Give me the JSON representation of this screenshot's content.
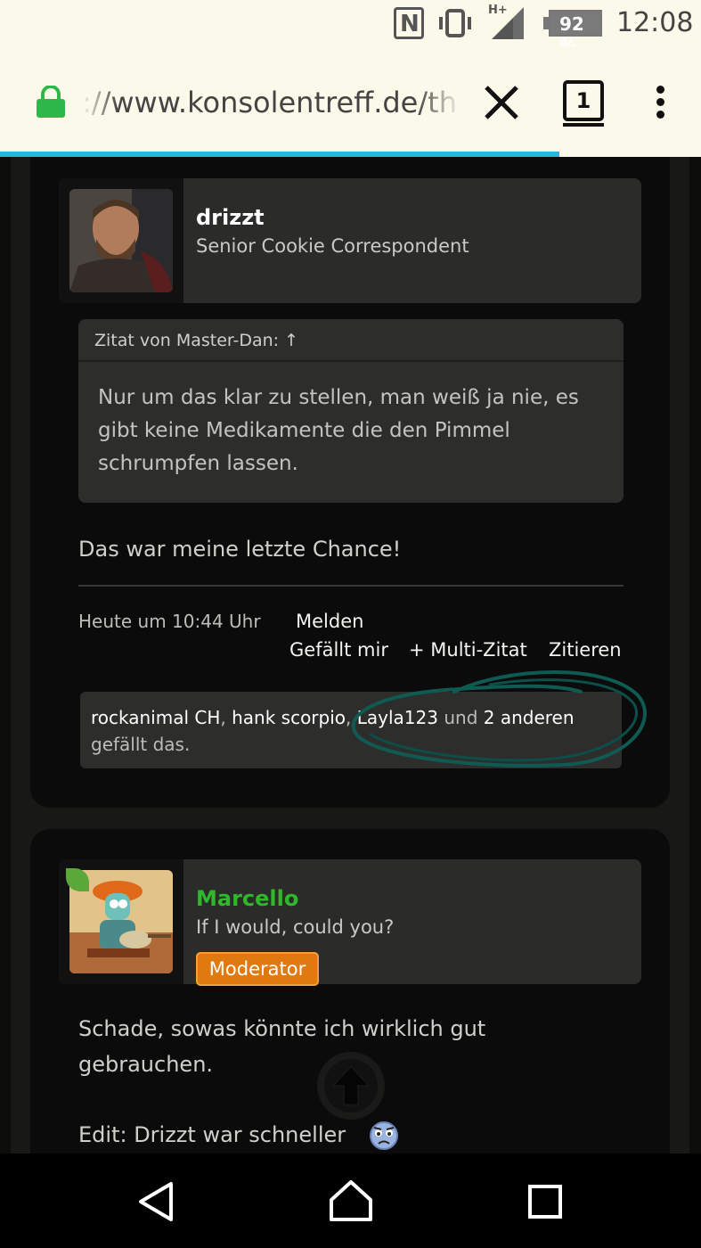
{
  "status_bar": {
    "nfc_label": "N",
    "network_label": "H+",
    "battery_text": "92 %",
    "time": "12:08",
    "icons": [
      "nfc-icon",
      "vibrate-icon",
      "signal-icon",
      "battery-icon"
    ]
  },
  "browser": {
    "url_text": "://www.konsolentreff.de/thr",
    "tab_count": "1",
    "lock_color": "#2fb84a",
    "progress_color": "#29b6e3",
    "icons": [
      "lock-icon",
      "close-icon",
      "tabs-icon",
      "menu-icon"
    ]
  },
  "post1": {
    "author_name": "drizzt",
    "author_title": "Senior Cookie Correspondent",
    "quote_header": "Zitat von Master-Dan: ↑",
    "quote_lines": [
      "Nur um das klar zu stellen, man weiß ja nie, es",
      "gibt keine Medikamente die den Pimmel",
      "schrumpfen lassen."
    ],
    "message": "Das war meine letzte Chance!",
    "timestamp": "Heute um 10:44 Uhr",
    "actions": {
      "report": "Melden",
      "like": "Gefällt mir",
      "multi_quote": "+ Multi-Zitat",
      "quote": "Zitieren"
    },
    "likes": {
      "user1": "rockanimal CH",
      "sep1": ",",
      "user2": "hank scorpio",
      "sep2": ",",
      "user3": "Layla123",
      "and": "und",
      "others": "2 anderen",
      "suffix": "gefällt das."
    }
  },
  "post2": {
    "author_name": "Marcello",
    "author_name_color": "#2fb82c",
    "author_title": "If I would, could you?",
    "badge": "Moderator",
    "badge_color": "#e0790f",
    "message_lines": [
      "Schade, sowas könnte ich wirklich gut",
      "gebrauchen."
    ],
    "edit_line": "Edit: Drizzt war schneller"
  },
  "controls": {
    "scroll_top_icon": "arrow-up-icon",
    "nav_icons": [
      "back-icon",
      "home-icon",
      "recents-icon"
    ]
  }
}
